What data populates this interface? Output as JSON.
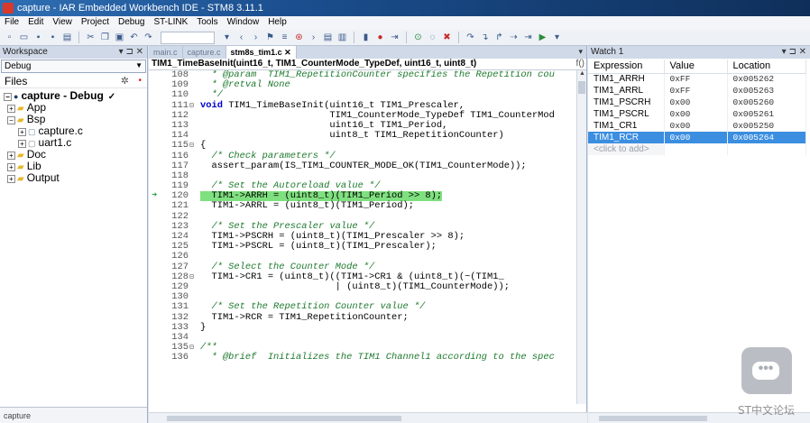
{
  "window": {
    "title": "capture - IAR Embedded Workbench IDE - STM8 3.11.1"
  },
  "menu": [
    "File",
    "Edit",
    "View",
    "Project",
    "Debug",
    "ST-LINK",
    "Tools",
    "Window",
    "Help"
  ],
  "workspace": {
    "header": "Workspace",
    "config": "Debug",
    "files_label": "Files",
    "project": "capture - Debug",
    "tree": [
      {
        "label": "App",
        "type": "folder",
        "level": 1,
        "expanded": false
      },
      {
        "label": "Bsp",
        "type": "folder",
        "level": 1,
        "expanded": true
      },
      {
        "label": "capture.c",
        "type": "file",
        "level": 2,
        "expanded": false
      },
      {
        "label": "uart1.c",
        "type": "file",
        "level": 2,
        "expanded": false
      },
      {
        "label": "Doc",
        "type": "folder",
        "level": 1,
        "expanded": false
      },
      {
        "label": "Lib",
        "type": "folder",
        "level": 1,
        "expanded": false
      },
      {
        "label": "Output",
        "type": "folder",
        "level": 1,
        "expanded": false
      }
    ],
    "footer_tab": "capture"
  },
  "editor": {
    "tabs": [
      {
        "label": "main.c",
        "active": false
      },
      {
        "label": "capture.c",
        "active": false
      },
      {
        "label": "stm8s_tim1.c",
        "active": true
      }
    ],
    "function_bar": "TIM1_TimeBaseInit(uint16_t, TIM1_CounterMode_TypeDef, uint16_t, uint8_t)",
    "current_line": 120,
    "lines": [
      {
        "n": "108",
        "fold": "",
        "text": "  * @param  TIM1_RepetitionCounter specifies the Repetition cou",
        "kind": "comment"
      },
      {
        "n": "109",
        "fold": "",
        "text": "  * @retval None",
        "kind": "comment"
      },
      {
        "n": "110",
        "fold": "",
        "text": "  */",
        "kind": "comment"
      },
      {
        "n": "111",
        "fold": "⊟",
        "text": "void TIM1_TimeBaseInit(uint16_t TIM1_Prescaler,",
        "kind": "void"
      },
      {
        "n": "112",
        "fold": "",
        "text": "                       TIM1_CounterMode_TypeDef TIM1_CounterMod",
        "kind": "code"
      },
      {
        "n": "113",
        "fold": "",
        "text": "                       uint16_t TIM1_Period,",
        "kind": "code"
      },
      {
        "n": "114",
        "fold": "",
        "text": "                       uint8_t TIM1_RepetitionCounter)",
        "kind": "code"
      },
      {
        "n": "115",
        "fold": "⊟",
        "text": "{",
        "kind": "code"
      },
      {
        "n": "116",
        "fold": "",
        "text": "  /* Check parameters */",
        "kind": "comment"
      },
      {
        "n": "117",
        "fold": "",
        "text": "  assert_param(IS_TIM1_COUNTER_MODE_OK(TIM1_CounterMode));",
        "kind": "code"
      },
      {
        "n": "118",
        "fold": "",
        "text": "",
        "kind": "code"
      },
      {
        "n": "119",
        "fold": "",
        "text": "  /* Set the Autoreload value */",
        "kind": "comment"
      },
      {
        "n": "120",
        "fold": "",
        "text": "  TIM1->ARRH = (uint8_t)(TIM1_Period >> 8);",
        "kind": "highlight"
      },
      {
        "n": "121",
        "fold": "",
        "text": "  TIM1->ARRL = (uint8_t)(TIM1_Period);",
        "kind": "code"
      },
      {
        "n": "122",
        "fold": "",
        "text": "",
        "kind": "code"
      },
      {
        "n": "123",
        "fold": "",
        "text": "  /* Set the Prescaler value */",
        "kind": "comment"
      },
      {
        "n": "124",
        "fold": "",
        "text": "  TIM1->PSCRH = (uint8_t)(TIM1_Prescaler >> 8);",
        "kind": "code"
      },
      {
        "n": "125",
        "fold": "",
        "text": "  TIM1->PSCRL = (uint8_t)(TIM1_Prescaler);",
        "kind": "code"
      },
      {
        "n": "126",
        "fold": "",
        "text": "",
        "kind": "code"
      },
      {
        "n": "127",
        "fold": "",
        "text": "  /* Select the Counter Mode */",
        "kind": "comment"
      },
      {
        "n": "128",
        "fold": "⊟",
        "text": "  TIM1->CR1 = (uint8_t)((TIM1->CR1 & (uint8_t)(~(TIM1_",
        "kind": "code"
      },
      {
        "n": "129",
        "fold": "",
        "text": "                        | (uint8_t)(TIM1_CounterMode));",
        "kind": "code"
      },
      {
        "n": "130",
        "fold": "",
        "text": "",
        "kind": "code"
      },
      {
        "n": "131",
        "fold": "",
        "text": "  /* Set the Repetition Counter value */",
        "kind": "comment"
      },
      {
        "n": "132",
        "fold": "",
        "text": "  TIM1->RCR = TIM1_RepetitionCounter;",
        "kind": "code"
      },
      {
        "n": "133",
        "fold": "",
        "text": "}",
        "kind": "code"
      },
      {
        "n": "134",
        "fold": "",
        "text": "",
        "kind": "code"
      },
      {
        "n": "135",
        "fold": "⊟",
        "text": "/**",
        "kind": "comment"
      },
      {
        "n": "136",
        "fold": "",
        "text": "  * @brief  Initializes the TIM1 Channel1 according to the spec",
        "kind": "comment"
      }
    ]
  },
  "watch": {
    "header": "Watch 1",
    "columns": [
      "Expression",
      "Value",
      "Location"
    ],
    "rows": [
      {
        "expr": "TIM1_ARRH",
        "value": "0xFF",
        "loc": "0x005262",
        "selected": false
      },
      {
        "expr": "TIM1_ARRL",
        "value": "0xFF",
        "loc": "0x005263",
        "selected": false
      },
      {
        "expr": "TIM1_PSCRH",
        "value": "0x00",
        "loc": "0x005260",
        "selected": false
      },
      {
        "expr": "TIM1_PSCRL",
        "value": "0x00",
        "loc": "0x005261",
        "selected": false
      },
      {
        "expr": "TIM1_CR1",
        "value": "0x00",
        "loc": "0x005250",
        "selected": false
      },
      {
        "expr": "TIM1_RCR",
        "value": "0x00",
        "loc": "0x005264",
        "selected": true
      }
    ],
    "add_hint": "<click to add>"
  },
  "overlay": {
    "watermark": "ST中文论坛"
  }
}
